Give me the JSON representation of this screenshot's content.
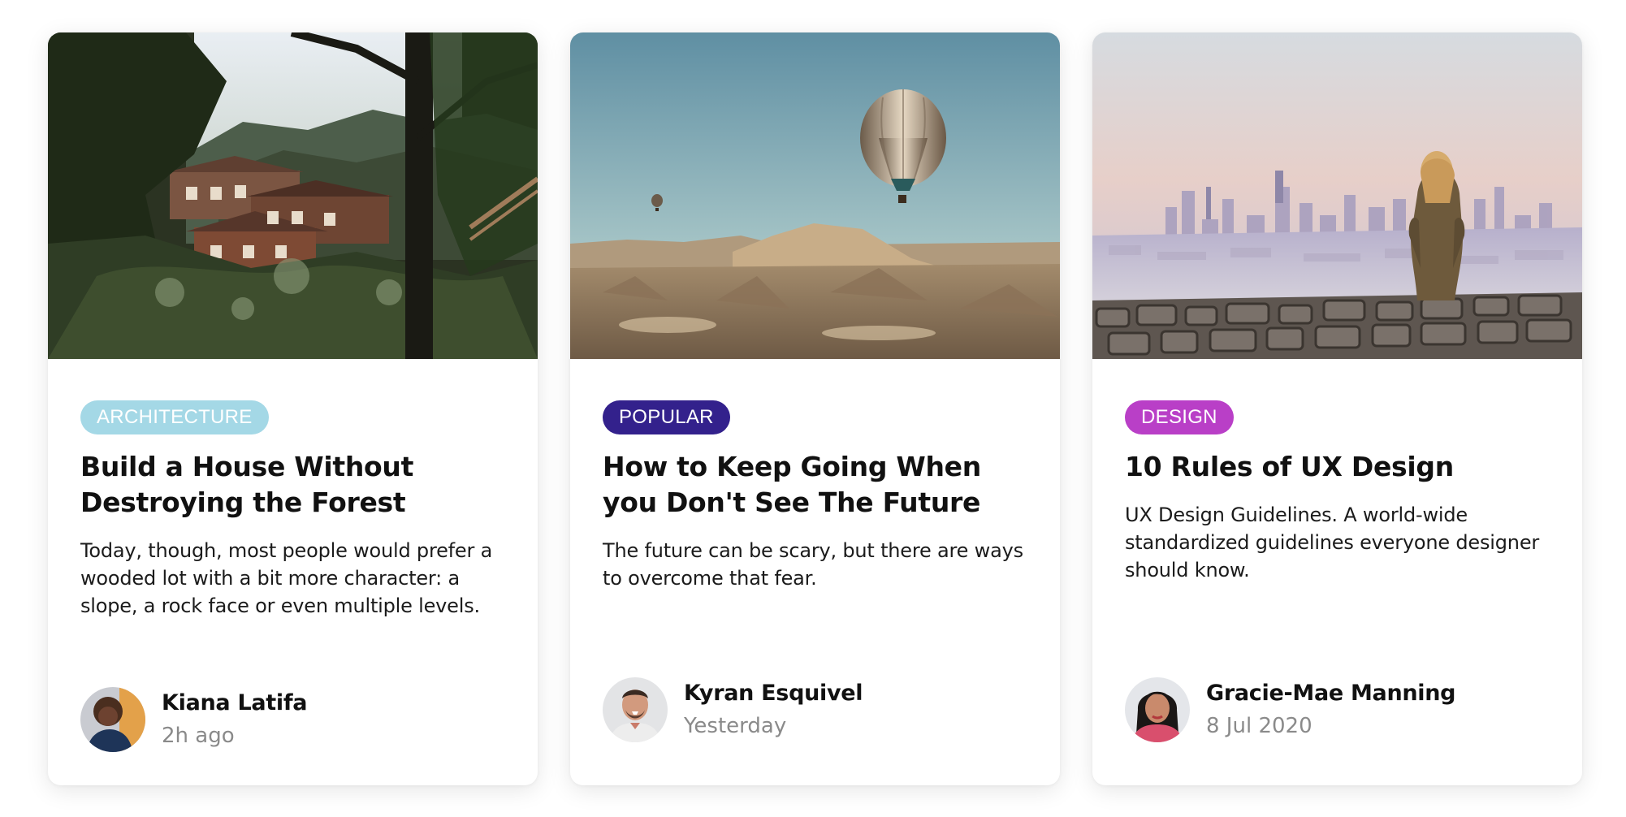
{
  "cards": [
    {
      "image": "forest-house-photo",
      "tag": {
        "label": "ARCHITECTURE",
        "color": "#a4d8e6"
      },
      "title": "Build a House Without Destroying the Forest",
      "text": "Today, though, most people would prefer a wooded lot with a bit more character: a slope, a rock face or even multiple levels.",
      "author": {
        "name": "Kiana Latifa",
        "time": "2h ago",
        "avatar": "avatar-kiana"
      }
    },
    {
      "image": "hot-air-balloon-photo",
      "tag": {
        "label": "POPULAR",
        "color": "#33218c"
      },
      "title": "How to Keep Going When you Don't See The Future",
      "text": "The future can be scary, but there are ways to overcome that fear.",
      "author": {
        "name": "Kyran Esquivel",
        "time": "Yesterday",
        "avatar": "avatar-kyran"
      }
    },
    {
      "image": "city-view-photo",
      "tag": {
        "label": "DESIGN",
        "color": "#b93fc7"
      },
      "title": "10 Rules of UX Design",
      "text": "UX Design Guidelines. A world-wide standardized guidelines everyone designer should know.",
      "author": {
        "name": "Gracie-Mae Manning",
        "time": "8 Jul 2020",
        "avatar": "avatar-gracie"
      }
    }
  ]
}
